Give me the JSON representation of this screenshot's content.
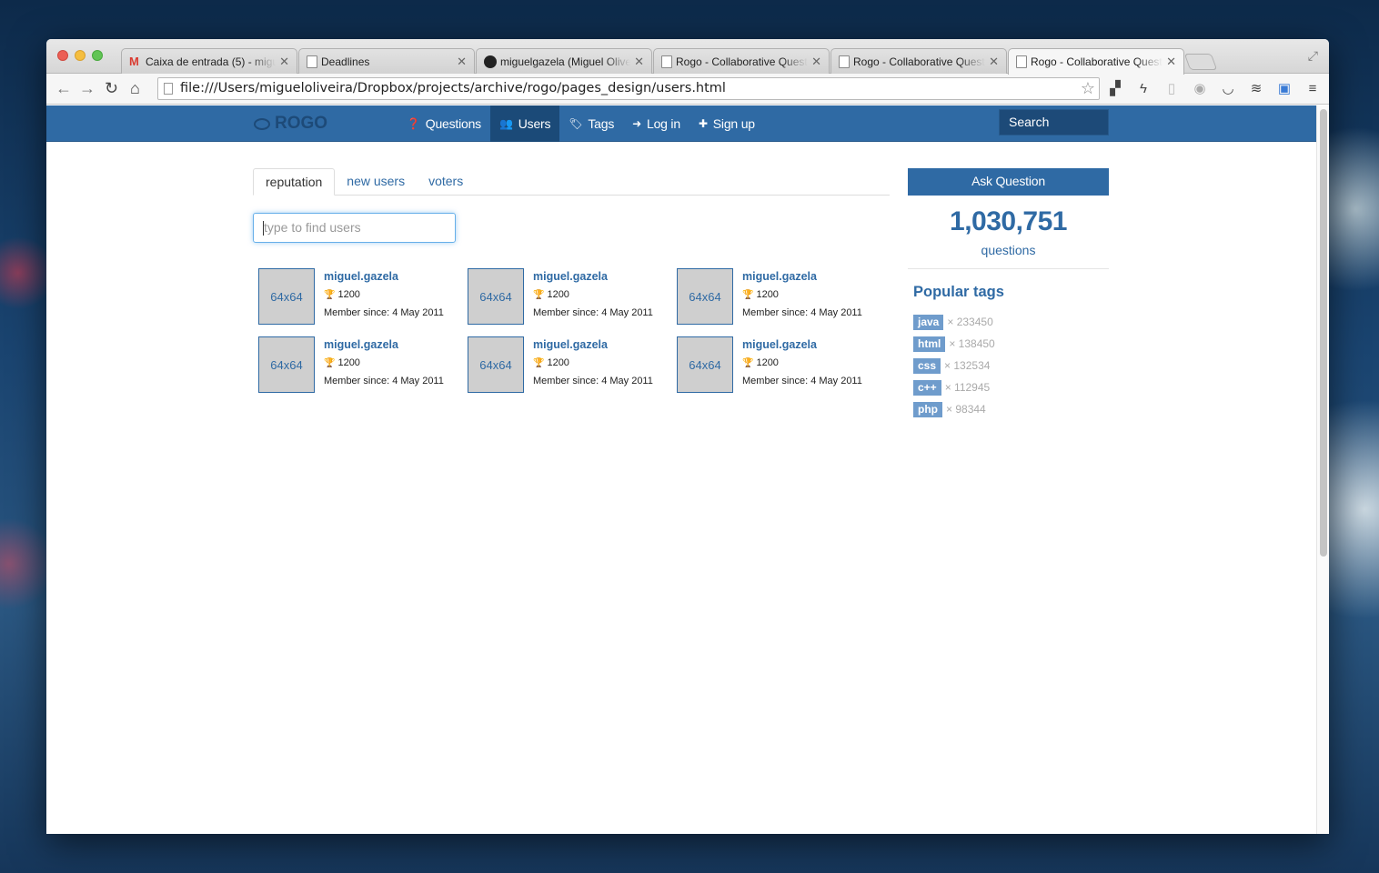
{
  "browser": {
    "tabs": [
      {
        "title": "Caixa de entrada (5) - miguel",
        "icon": "gmail-icon"
      },
      {
        "title": "Deadlines",
        "icon": "page-icon"
      },
      {
        "title": "miguelgazela (Miguel Oliveira)",
        "icon": "github-icon"
      },
      {
        "title": "Rogo - Collaborative Questions",
        "icon": "page-icon"
      },
      {
        "title": "Rogo - Collaborative Questions",
        "icon": "page-icon"
      },
      {
        "title": "Rogo - Collaborative Questions",
        "icon": "page-icon",
        "active": true
      }
    ],
    "url": "file:///Users/migueloliveira/Dropbox/projects/archive/rogo/pages_design/users.html"
  },
  "navbar": {
    "brand": "ROGO",
    "links": [
      {
        "label": "Questions",
        "icon": "question-circle-icon"
      },
      {
        "label": "Users",
        "icon": "users-icon",
        "active": true
      },
      {
        "label": "Tags",
        "icon": "tags-icon"
      },
      {
        "label": "Log in",
        "icon": "sign-in-icon"
      },
      {
        "label": "Sign up",
        "icon": "plus-icon"
      }
    ],
    "search_placeholder": "Search"
  },
  "user_tabs": [
    {
      "label": "reputation",
      "active": true
    },
    {
      "label": "new users"
    },
    {
      "label": "voters"
    }
  ],
  "find_users_placeholder": "type to find users",
  "users": [
    {
      "avatar": "64x64",
      "name": "miguel.gazela",
      "reputation": "1200",
      "since": "Member since: 4 May 2011"
    },
    {
      "avatar": "64x64",
      "name": "miguel.gazela",
      "reputation": "1200",
      "since": "Member since: 4 May 2011"
    },
    {
      "avatar": "64x64",
      "name": "miguel.gazela",
      "reputation": "1200",
      "since": "Member since: 4 May 2011"
    },
    {
      "avatar": "64x64",
      "name": "miguel.gazela",
      "reputation": "1200",
      "since": "Member since: 4 May 2011"
    },
    {
      "avatar": "64x64",
      "name": "miguel.gazela",
      "reputation": "1200",
      "since": "Member since: 4 May 2011"
    },
    {
      "avatar": "64x64",
      "name": "miguel.gazela",
      "reputation": "1200",
      "since": "Member since: 4 May 2011"
    }
  ],
  "sidebar": {
    "ask_label": "Ask Question",
    "question_count": "1,030,751",
    "question_label": "questions",
    "popular_title": "Popular tags",
    "tags": [
      {
        "name": "java",
        "count": "× 233450"
      },
      {
        "name": "html",
        "count": "× 138450"
      },
      {
        "name": "css",
        "count": "× 132534"
      },
      {
        "name": "c++",
        "count": "× 112945"
      },
      {
        "name": "php",
        "count": "× 98344"
      }
    ]
  },
  "colors": {
    "brand_blue": "#2f6aa4",
    "nav_active": "#1b4a78",
    "tag_chip": "#6f9ccc"
  }
}
